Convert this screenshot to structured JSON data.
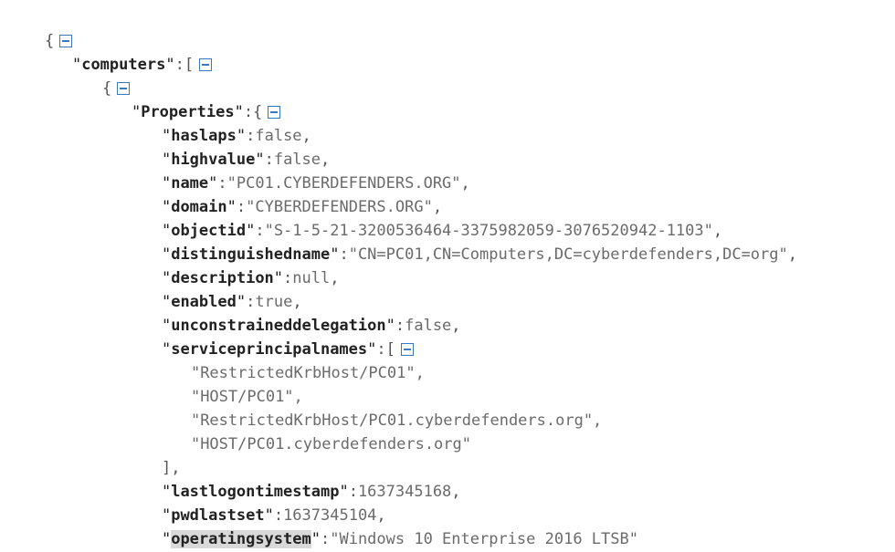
{
  "viewer": {
    "computers_key": "computers",
    "properties_key": "Properties",
    "fields": {
      "haslaps": {
        "key": "haslaps",
        "value": "false"
      },
      "highvalue": {
        "key": "highvalue",
        "value": "false"
      },
      "name": {
        "key": "name",
        "value": "\"PC01.CYBERDEFENDERS.ORG\""
      },
      "domain": {
        "key": "domain",
        "value": "\"CYBERDEFENDERS.ORG\""
      },
      "objectid": {
        "key": "objectid",
        "value": "\"S-1-5-21-3200536464-3375982059-3076520942-1103\""
      },
      "distinguishedname": {
        "key": "distinguishedname",
        "value": "\"CN=PC01,CN=Computers,DC=cyberdefenders,DC=org\""
      },
      "description": {
        "key": "description",
        "value": "null"
      },
      "enabled": {
        "key": "enabled",
        "value": "true"
      },
      "unconstraineddelegation": {
        "key": "unconstraineddelegation",
        "value": "false"
      },
      "serviceprincipalnames": {
        "key": "serviceprincipalnames"
      },
      "lastlogontimestamp": {
        "key": "lastlogontimestamp",
        "value": "1637345168"
      },
      "pwdlastset": {
        "key": "pwdlastset",
        "value": "1637345104"
      },
      "operatingsystem": {
        "key": "operatingsystem",
        "value": "\"Windows 10 Enterprise 2016 LTSB\""
      }
    },
    "spn_values": [
      "\"RestrictedKrbHost/PC01\",",
      "\"HOST/PC01\",",
      "\"RestrictedKrbHost/PC01.cyberdefenders.org\",",
      "\"HOST/PC01.cyberdefenders.org\""
    ]
  }
}
